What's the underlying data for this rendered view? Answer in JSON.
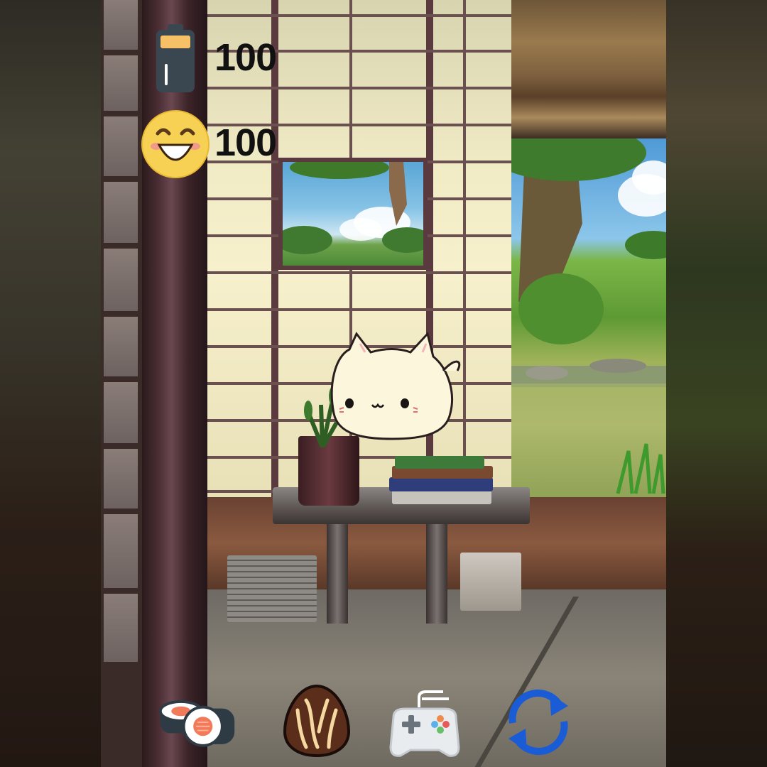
{
  "hud": {
    "energy": {
      "icon": "battery-icon",
      "value": "100"
    },
    "happiness": {
      "icon": "smiley-face-icon",
      "value": "100"
    }
  },
  "actions": [
    {
      "id": "feed-sushi",
      "icon": "sushi-roll-icon"
    },
    {
      "id": "feed-chocolate",
      "icon": "chocolate-truffle-icon"
    },
    {
      "id": "play-game",
      "icon": "game-controller-icon"
    },
    {
      "id": "refresh",
      "icon": "refresh-arrows-icon",
      "color": "#1a5bd6"
    }
  ],
  "colors": {
    "battery_fill": "#f5c066",
    "smiley": "#f7d154",
    "refresh": "#1a5bd6"
  }
}
